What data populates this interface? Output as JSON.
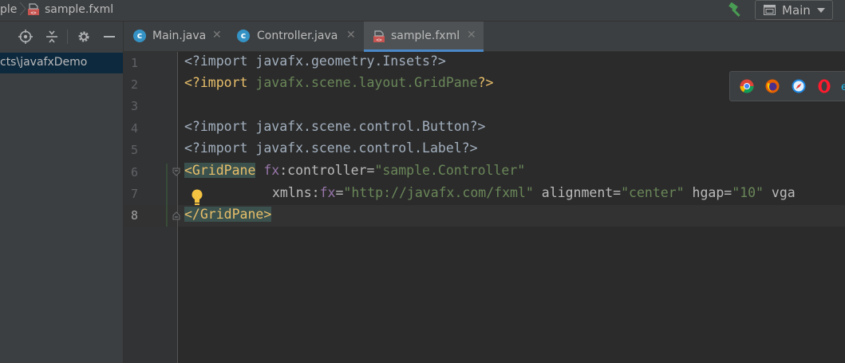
{
  "navbar": {
    "crumb_partial": "ple",
    "file_name": "sample.fxml",
    "run_config": "Main"
  },
  "project_panel": {
    "selected_path": "cts\\javafxDemo"
  },
  "tabs": [
    {
      "label": "Main.java",
      "icon": "java-class-run-icon",
      "active": false
    },
    {
      "label": "Controller.java",
      "icon": "java-class-icon",
      "active": false
    },
    {
      "label": "sample.fxml",
      "icon": "fxml-file-icon",
      "active": true
    }
  ],
  "tab_close_glyph": "✕",
  "editor": {
    "line_numbers": [
      "1",
      "2",
      "3",
      "4",
      "5",
      "6",
      "7",
      "8"
    ],
    "current_line": "8",
    "lines": {
      "l1": "<?import javafx.geometry.Insets?>",
      "l2_a": "<?import ",
      "l2_b": "javafx.scene.layout.GridPane",
      "l2_c": "?>",
      "l4": "<?import javafx.scene.control.Button?>",
      "l5": "<?import javafx.scene.control.Label?>",
      "l6_tag": "<GridPane",
      "l6_ns": "fx",
      "l6_attr": ":controller=",
      "l6_val": "\"sample.Controller\"",
      "l7_attr1": "xmlns:",
      "l7_ns": "fx",
      "l7_eq": "=",
      "l7_val1": "\"http://javafx.com/fxml\"",
      "l7_attr2": "alignment=",
      "l7_val2": "\"center\"",
      "l7_attr3": "hgap=",
      "l7_val3": "\"10\"",
      "l7_attr4": "vga",
      "l8_tag": "</GridPane>"
    }
  },
  "colors": {
    "background": "#2b2b2b",
    "panel": "#3c3f41",
    "tab_underline": "#4a88c7",
    "string": "#6a8759",
    "tag": "#e8bf6a",
    "namespace": "#9876aa"
  },
  "browser_popup": [
    "chrome-icon",
    "firefox-icon",
    "safari-icon",
    "opera-icon",
    "ie-icon"
  ]
}
